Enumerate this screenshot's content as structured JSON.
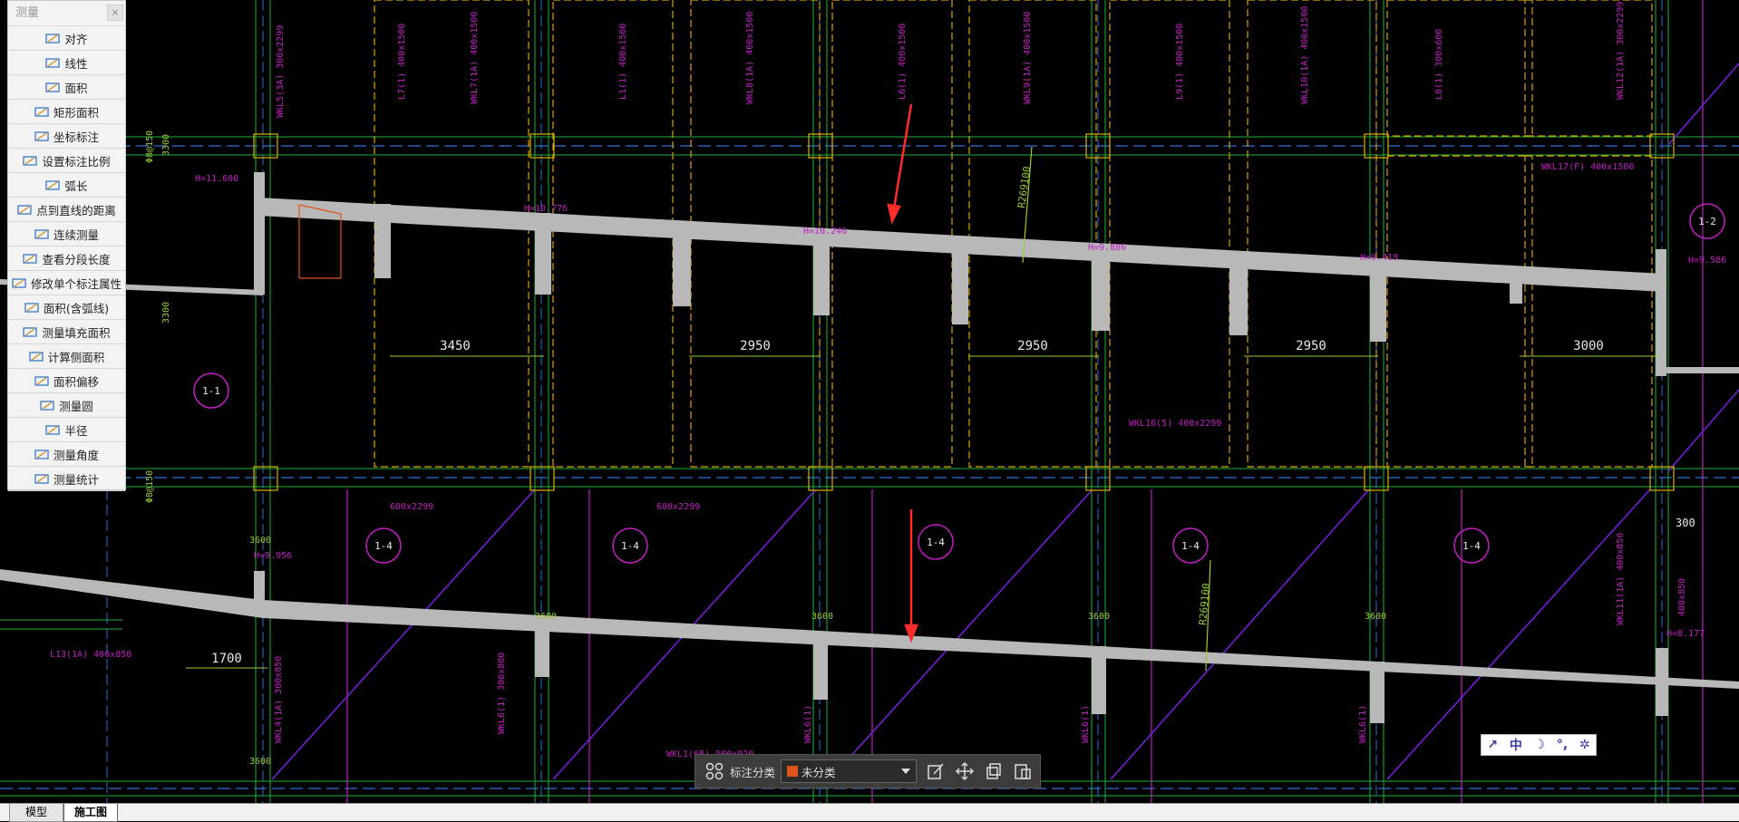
{
  "measure_panel": {
    "title": "测量",
    "close_glyph": "×",
    "tools": [
      {
        "label": "对齐",
        "icon": "aligned-dimension-icon"
      },
      {
        "label": "线性",
        "icon": "linear-dimension-icon"
      },
      {
        "label": "面积",
        "icon": "area-icon"
      },
      {
        "label": "矩形面积",
        "icon": "rect-area-icon"
      },
      {
        "label": "坐标标注",
        "icon": "coordinate-icon"
      },
      {
        "label": "设置标注比例",
        "icon": "scale-icon"
      },
      {
        "label": "弧长",
        "icon": "arc-length-icon"
      },
      {
        "label": "点到直线的距离",
        "icon": "point-line-distance-icon"
      },
      {
        "label": "连续测量",
        "icon": "continuous-measure-icon"
      },
      {
        "label": "查看分段长度",
        "icon": "segment-length-icon"
      },
      {
        "label": "修改单个标注属性",
        "icon": "edit-annotation-icon"
      },
      {
        "label": "面积(含弧线)",
        "icon": "arc-area-icon"
      },
      {
        "label": "测量填充面积",
        "icon": "fill-area-icon"
      },
      {
        "label": "计算侧面积",
        "icon": "side-area-icon"
      },
      {
        "label": "面积偏移",
        "icon": "area-offset-icon"
      },
      {
        "label": "测量圆",
        "icon": "circle-measure-icon"
      },
      {
        "label": "半径",
        "icon": "radius-icon"
      },
      {
        "label": "测量角度",
        "icon": "angle-icon"
      },
      {
        "label": "测量统计",
        "icon": "statistics-icon"
      }
    ]
  },
  "annotation_bar": {
    "label": "标注分类",
    "selected": "未分类",
    "swatch_color": "#e0541c"
  },
  "mini_toolbar": {
    "items": [
      "↗",
      "中",
      "☽",
      "°,",
      "✲"
    ]
  },
  "tabs": [
    {
      "label": "模型",
      "active": false
    },
    {
      "label": "施工图",
      "active": true
    }
  ],
  "drawing": {
    "dimensions_upper": [
      "3450",
      "2950",
      "2950",
      "2950",
      "3000"
    ],
    "dimension_lower": "1700",
    "elevations": [
      "H=11.600",
      "H=10.776",
      "H=10.246",
      "H=9.886",
      "H=9.419",
      "H=9.586",
      "H=9.956",
      "H=8.177"
    ],
    "beam_labels_top": [
      "WKL5(3A) 300x2299",
      "L7(1) 400x1500",
      "WKL7(1A) 400x1500",
      "L1(1) 400x1500",
      "WKL8(1A) 400x1500",
      "L6(1) 400x1500",
      "WKL9(1A) 400x1500",
      "L9(1) 400x1500",
      "WKL10(1A) 400x1500",
      "L8(1) 300x600",
      "WKL12(1A) 300x2299"
    ],
    "beam_labels_other": [
      "WKL17(F) 400x1500",
      "WKL16(5) 400x2299",
      "600x2299",
      "600x2299",
      "L13(1A) 400x850",
      "WKL4(1A) 300x850",
      "WKL6(1) 300x800",
      "WKL6(1)",
      "WKL6(1)",
      "WKL6(1)",
      "WKL1(6B) 500x920",
      "WKL11(1A) 400x850",
      "400x850"
    ],
    "section_marks": [
      "1-1",
      "1-2",
      "1-4",
      "1-4",
      "1-4",
      "1-4",
      "1-4"
    ],
    "radius_labels": [
      "R269100",
      "R269100"
    ],
    "axis_label": "Φ8@150",
    "dim_3600": "3600",
    "dim_300": "300",
    "dim_3300": "3300"
  }
}
